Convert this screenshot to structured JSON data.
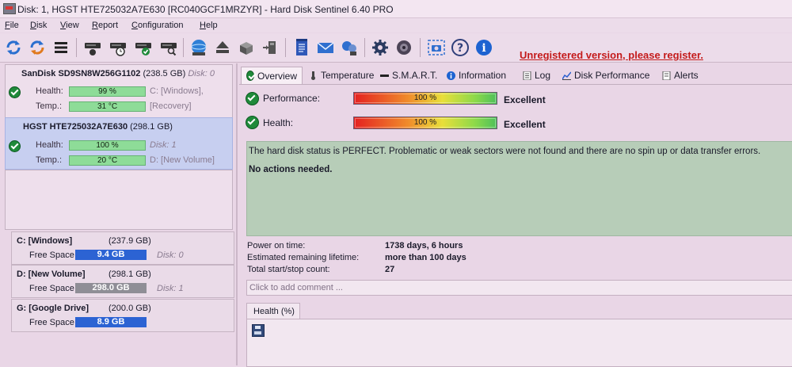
{
  "window": {
    "title": "Disk: 1, HGST HTE725032A7E630 [RC040GCF1MRZYR]  -  Hard Disk Sentinel 6.40 PRO"
  },
  "menu": {
    "items": [
      {
        "first": "F",
        "rest": "ile"
      },
      {
        "first": "D",
        "rest": "isk"
      },
      {
        "first": "V",
        "rest": "iew"
      },
      {
        "first": "R",
        "rest": "eport"
      },
      {
        "first": "C",
        "rest": "onfiguration"
      },
      {
        "first": "H",
        "rest": "elp"
      }
    ]
  },
  "toolbar": {
    "icons": [
      "refresh-icon",
      "refresh-all-icon",
      "disk-list-icon",
      "disk-test-icon",
      "disk-schedule-icon",
      "disk-check-icon",
      "disk-search-icon",
      "disk-surface-icon",
      "eject-icon",
      "network-disk-icon",
      "external-disk-icon",
      "report-icon",
      "mail-icon",
      "share-icon",
      "settings-icon",
      "sound-icon",
      "screenshot-icon",
      "help-icon",
      "info-icon"
    ],
    "unregistered": "Unregistered version, please register."
  },
  "disks": [
    {
      "name": "SanDisk SD9SN8W256G1102",
      "size": "(238.5 GB)",
      "disk_label": "Disk: 0",
      "health_label": "Health:",
      "health_value": "99 %",
      "health_level": 0.99,
      "vol_info": "C: [Windows],",
      "temp_label": "Temp.:",
      "temp_value": "31 °C",
      "vol_info2": "[Recovery]"
    },
    {
      "name": "HGST HTE725032A7E630",
      "size": "(298.1 GB)",
      "disk_label": "",
      "health_label": "Health:",
      "health_value": "100 %",
      "health_level": 1.0,
      "vol_info": "Disk: 1",
      "temp_label": "Temp.:",
      "temp_value": "20 °C",
      "vol_info2": "D: [New Volume]"
    }
  ],
  "volumes": [
    {
      "name": "C: [Windows]",
      "size": "(237.9 GB)",
      "free_label": "Free Space",
      "free": "9.4 GB",
      "disk": "Disk: 0",
      "bar_color": "#2c63d3"
    },
    {
      "name": "D: [New Volume]",
      "size": "(298.1 GB)",
      "free_label": "Free Space",
      "free": "298.0 GB",
      "disk": "Disk: 1",
      "bar_color": "#8f8e96"
    },
    {
      "name": "G: [Google Drive]",
      "size": "(200.0 GB)",
      "free_label": "Free Space",
      "free": "8.9 GB",
      "disk": "",
      "bar_color": "#2c63d3"
    }
  ],
  "tabs": [
    "Overview",
    "Temperature",
    "S.M.A.R.T.",
    "Information",
    "Log",
    "Disk Performance",
    "Alerts"
  ],
  "overview": {
    "performance_label": "Performance:",
    "performance_value": "100 %",
    "performance_result": "Excellent",
    "health_label": "Health:",
    "health_value": "100 %",
    "health_result": "Excellent",
    "status_text": "The hard disk status is PERFECT. Problematic or weak sectors were not found and there are no spin up or data transfer errors.",
    "action_text": "No actions needed.",
    "stats": [
      {
        "label": "Power on time:",
        "value": "1738 days, 6 hours"
      },
      {
        "label": "Estimated remaining lifetime:",
        "value": "more than 100 days"
      },
      {
        "label": "Total start/stop count:",
        "value": "27"
      }
    ],
    "comment_placeholder": "Click to add comment ...",
    "health_chart_tab": "Health (%)"
  }
}
